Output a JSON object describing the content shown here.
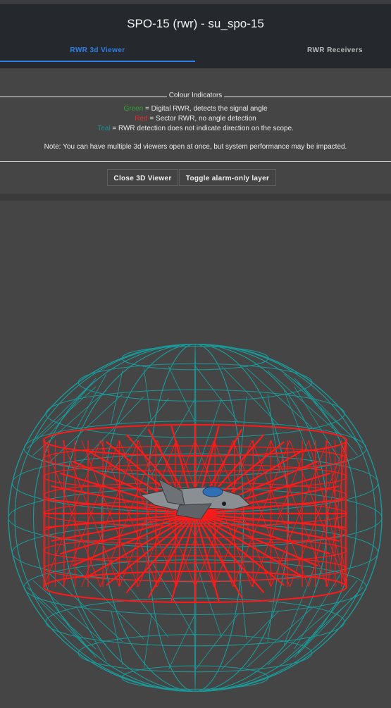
{
  "window": {
    "title": "SPO-15 (rwr) - su_spo-15"
  },
  "tabs": [
    {
      "label": "RWR 3d Viewer",
      "active": true
    },
    {
      "label": "RWR Receivers",
      "active": false
    }
  ],
  "colour_indicators": {
    "legend": "Colour Indicators",
    "green": {
      "word": "Green",
      "text": " = Digital RWR, detects the signal angle",
      "color": "#2fa52f"
    },
    "red": {
      "word": "Red",
      "text": " = Sector RWR, no angle detection",
      "color": "#e03030"
    },
    "teal": {
      "word": "Teal",
      "text": " = RWR detection does not indicate direction on the scope.",
      "color": "#1e8c8c"
    },
    "note": "Note: You can have multiple 3d viewers open at once, but system performance may be impacted."
  },
  "buttons": {
    "close": "Close 3D Viewer",
    "toggle": "Toggle alarm-only layer"
  },
  "viewer": {
    "teal_color": "#1a9a9a",
    "red_color": "#ff1a1a",
    "aircraft_color": "#8a8f94"
  }
}
